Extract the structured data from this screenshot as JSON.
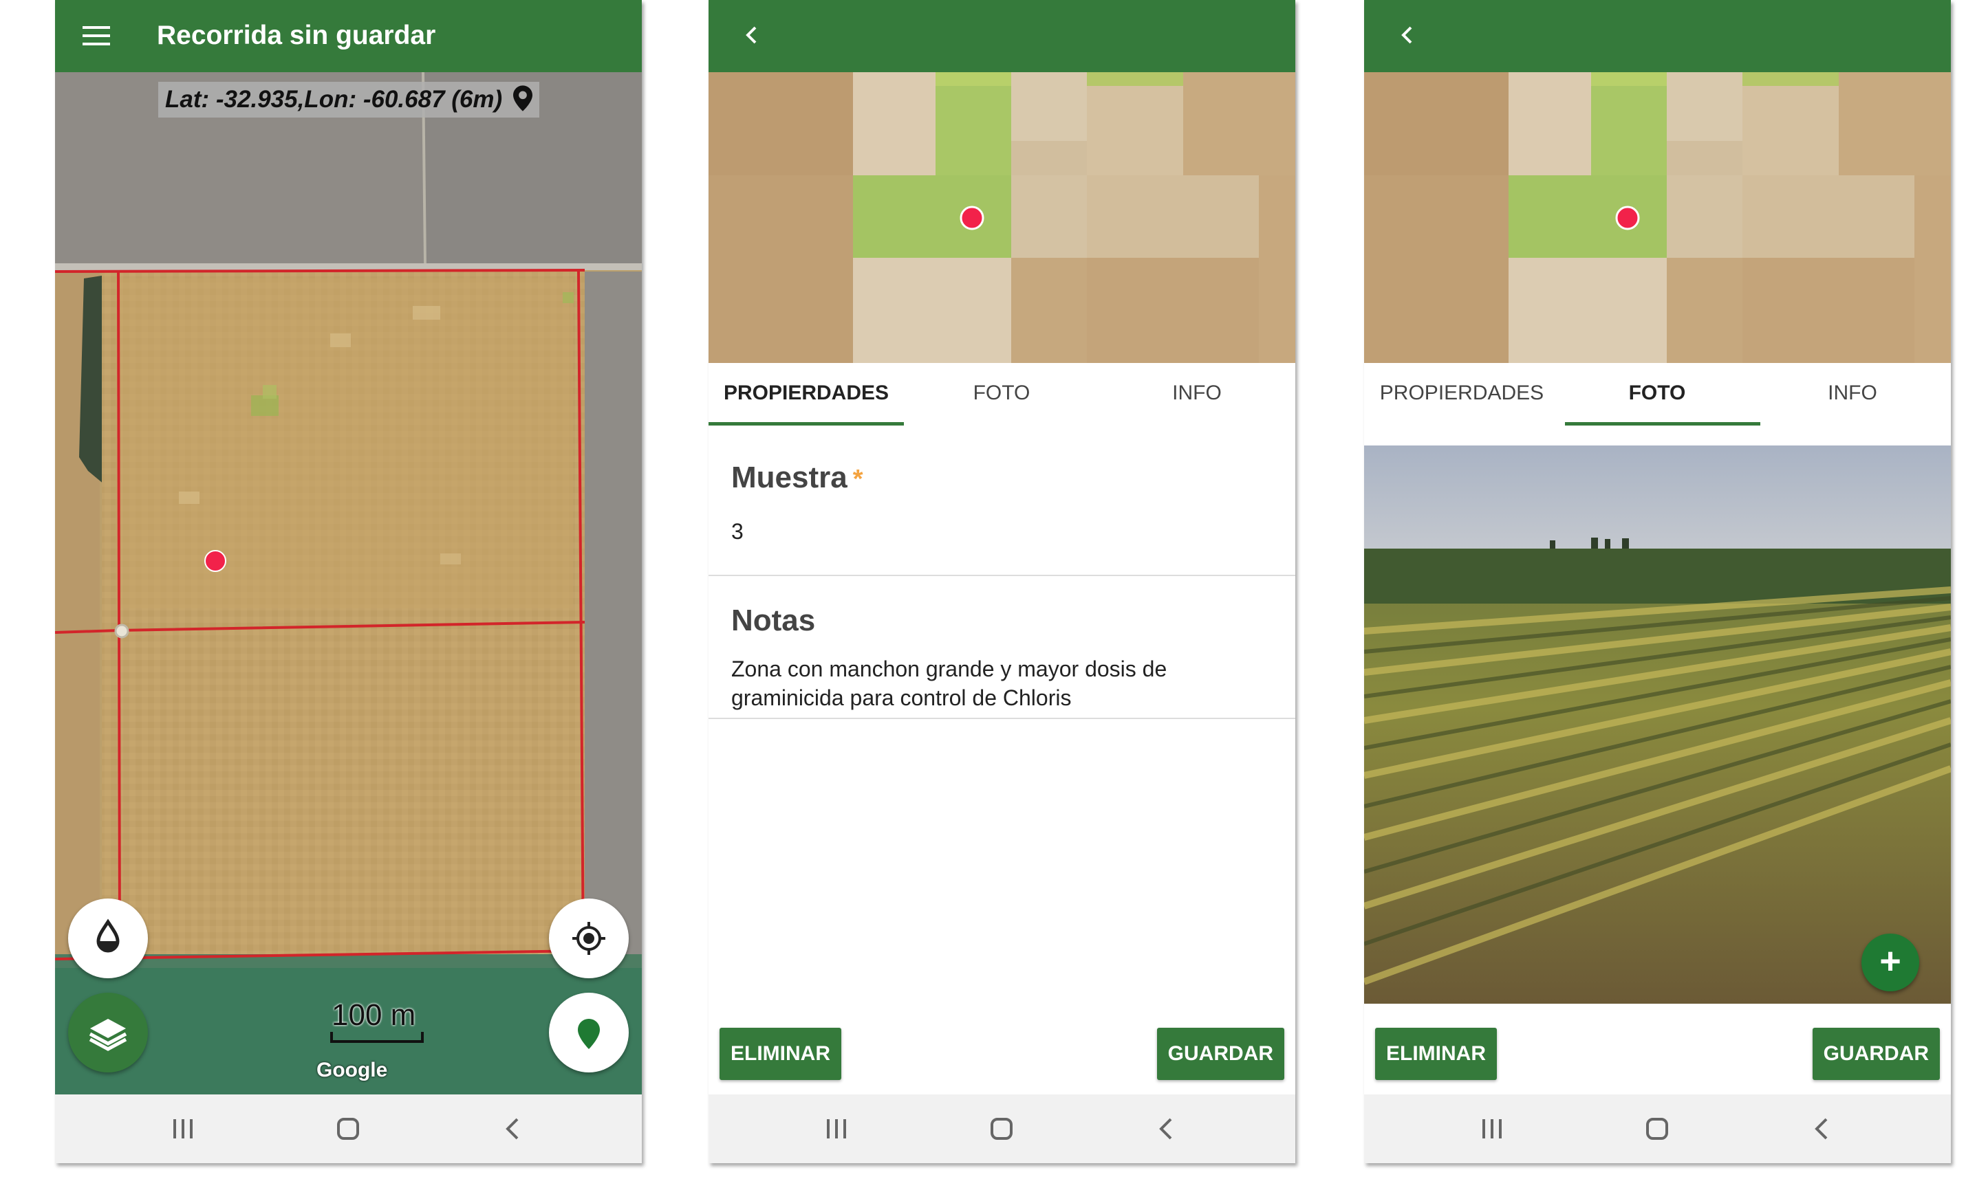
{
  "screen1": {
    "title": "Recorrida sin guardar",
    "coordinates": "Lat: -32.935,Lon: -60.687 (6m)",
    "scale_label": "100 m",
    "map_attribution": "Google",
    "icons": [
      "menu-icon",
      "location-pin-icon",
      "water-drop-icon",
      "crosshair-icon",
      "layers-icon",
      "place-marker-icon"
    ]
  },
  "screen2": {
    "tabs": [
      "PROPIERDADES",
      "FOTO",
      "INFO"
    ],
    "active_tab": "PROPIERDADES",
    "fields": [
      {
        "label": "Muestra",
        "required_mark": "*",
        "value": "3"
      },
      {
        "label": "Notas",
        "value": "Zona con manchon grande y mayor dosis de graminicida para control de Chloris"
      }
    ],
    "delete_label": "ELIMINAR",
    "save_label": "GUARDAR"
  },
  "screen3": {
    "tabs": [
      "PROPIERDADES",
      "FOTO",
      "INFO"
    ],
    "active_tab": "FOTO",
    "add_photo_label": "+",
    "delete_label": "ELIMINAR",
    "save_label": "GUARDAR"
  },
  "colors": {
    "primary": "#357a3b",
    "marker": "#f2224a",
    "required": "#f4a340",
    "navbar": "#f1f1f1"
  }
}
